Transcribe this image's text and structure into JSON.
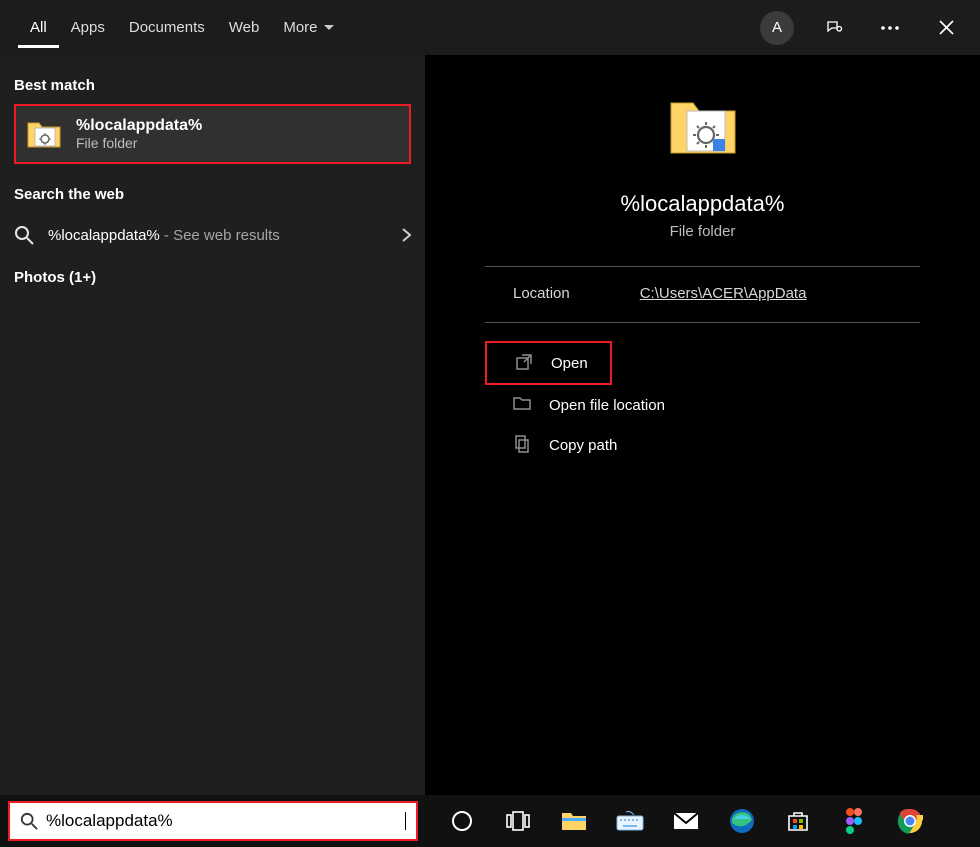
{
  "tabs": {
    "items": [
      "All",
      "Apps",
      "Documents",
      "Web",
      "More"
    ],
    "active": 0
  },
  "topRight": {
    "avatarLetter": "A"
  },
  "left": {
    "bestMatchLabel": "Best match",
    "bestMatch": {
      "title": "%localappdata%",
      "subtitle": "File folder"
    },
    "searchWebLabel": "Search the web",
    "webResult": {
      "query": "%localappdata%",
      "suffix": " - See web results"
    },
    "photosLabel": "Photos (1+)"
  },
  "preview": {
    "title": "%localappdata%",
    "subtitle": "File folder",
    "locationLabel": "Location",
    "locationValue": "C:\\Users\\ACER\\AppData",
    "actions": {
      "open": "Open",
      "openLocation": "Open file location",
      "copyPath": "Copy path"
    }
  },
  "search": {
    "value": "%localappdata%"
  }
}
